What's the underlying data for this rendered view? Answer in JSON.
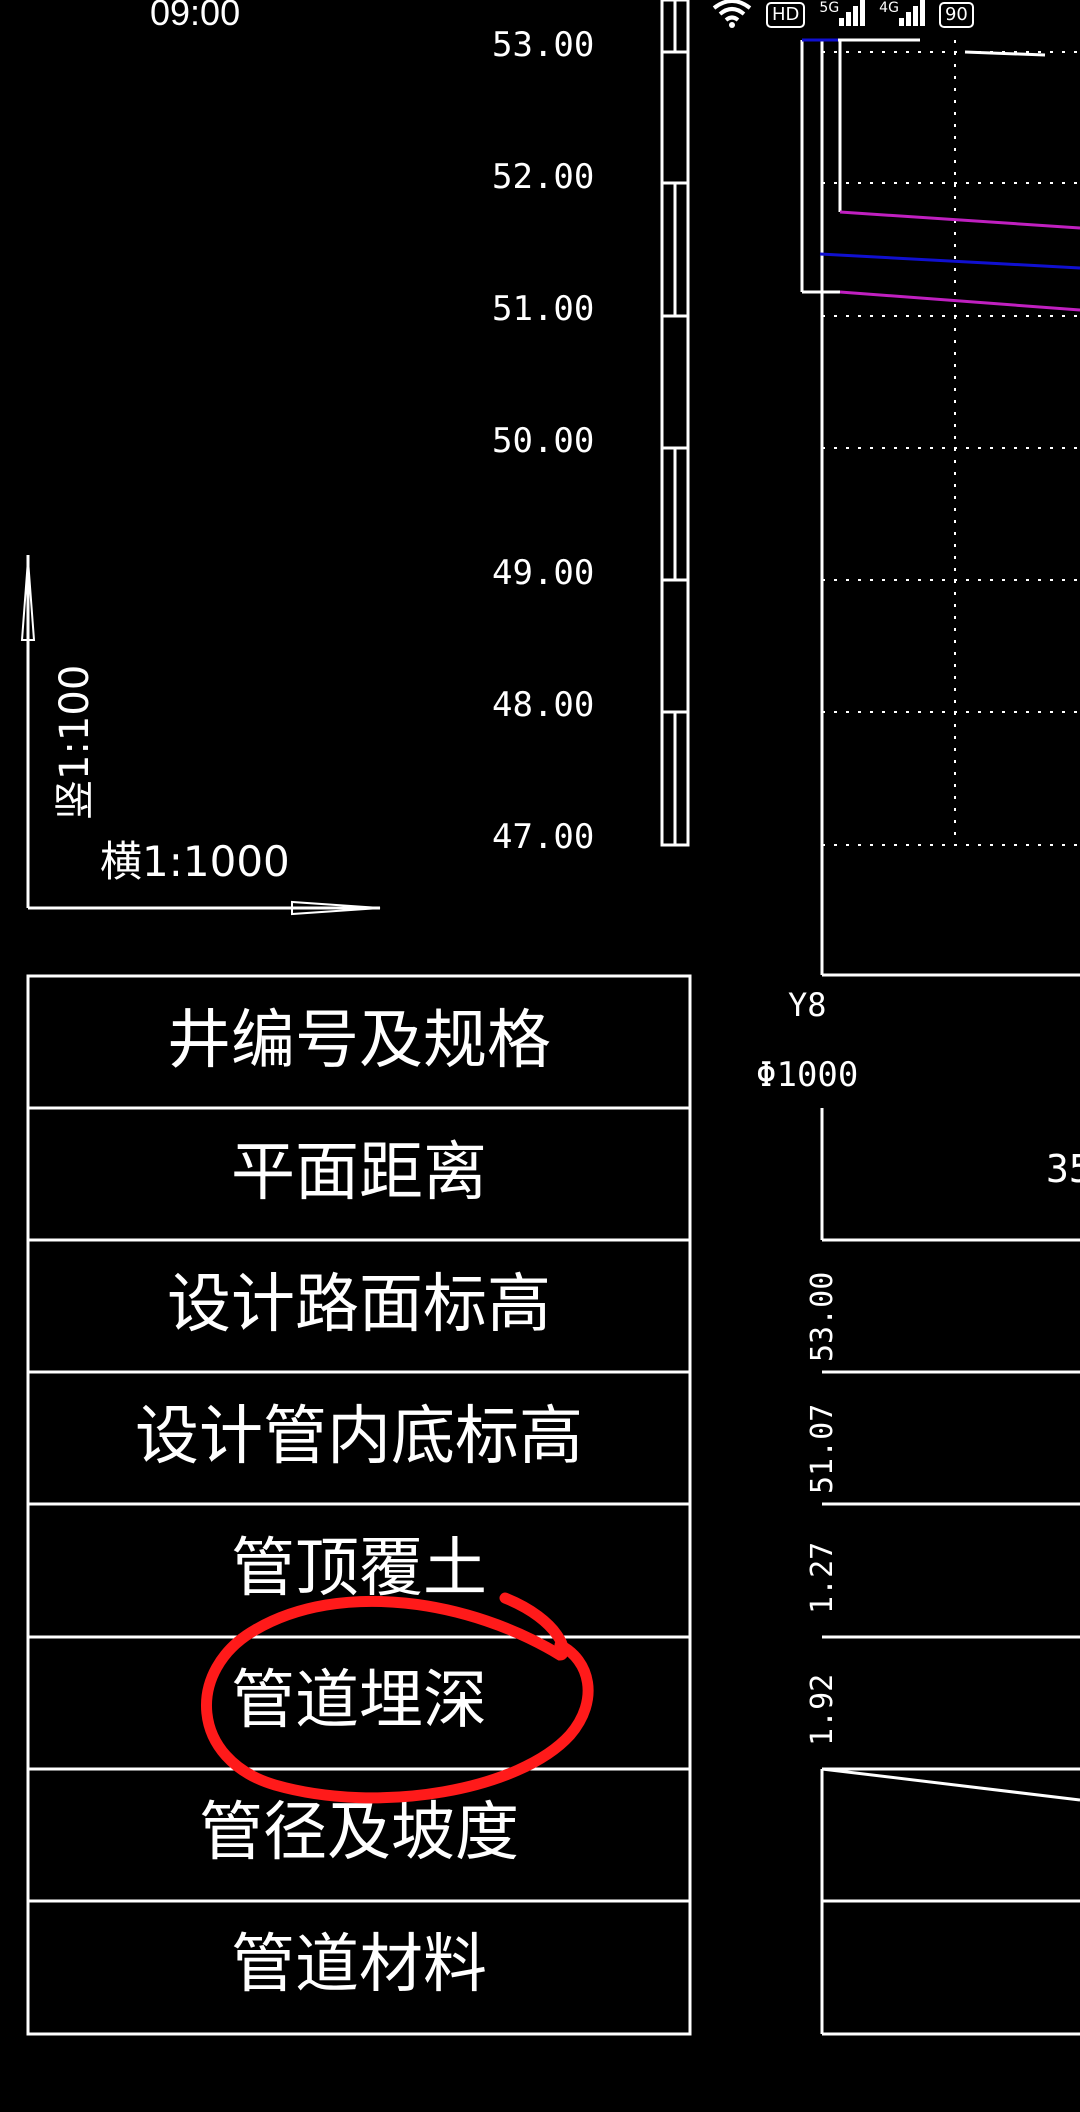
{
  "status_bar": {
    "time": "09:00",
    "hd_badge": "HD",
    "signal_5g": "5G",
    "signal_4g": "4G",
    "battery": "90"
  },
  "elevation_ruler": {
    "labels": [
      "53.00",
      "52.00",
      "51.00",
      "50.00",
      "49.00",
      "48.00",
      "47.00"
    ]
  },
  "scale_legend": {
    "vertical": "竖1:100",
    "horizontal": "横1:1000"
  },
  "table": {
    "rows": [
      "井编号及规格",
      "平面距离",
      "设计路面标高",
      "设计管内底标高",
      "管顶覆土",
      "管道埋深",
      "管径及坡度",
      "管道材料"
    ]
  },
  "profile": {
    "well_id": "Y8",
    "diameter": "Φ1000",
    "distance_partial": "35",
    "road_elevation": "53.00",
    "invert_elevation": "51.07",
    "cover": "1.27",
    "burial_depth": "1.92"
  },
  "colors": {
    "magenta": "#c020c0",
    "blue": "#1010d0",
    "annotation_red": "#ff1a1a"
  }
}
